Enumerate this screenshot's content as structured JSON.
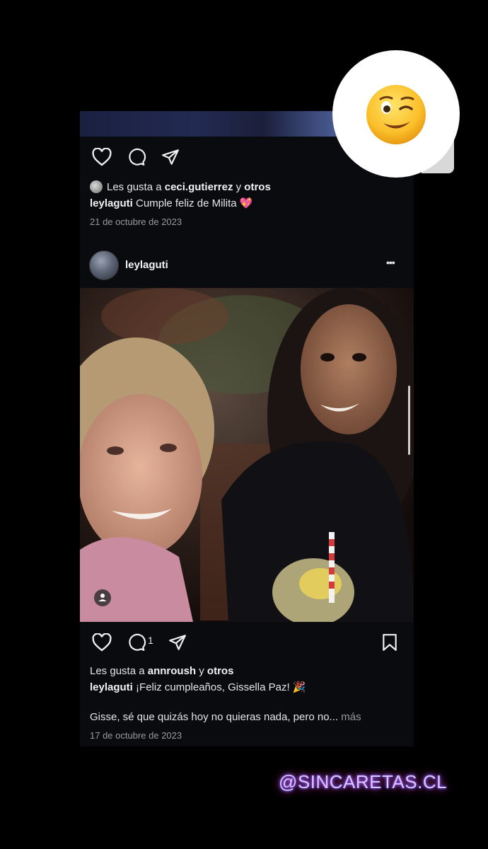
{
  "post1": {
    "likes_prefix": "Les gusta a",
    "likes_user": "ceci.gutierrez",
    "likes_and": "y",
    "likes_others": "otros",
    "caption_user": "leylaguti",
    "caption_text": "Cumple feliz de Milita 💖",
    "date": "21 de octubre de 2023"
  },
  "post2": {
    "username": "leylaguti",
    "more_label": "•••",
    "comment_count": "1",
    "likes_prefix": "Les gusta a",
    "likes_user": "annroush",
    "likes_and": "y",
    "likes_others": "otros",
    "caption_user": "leylaguti",
    "caption_text": "¡Feliz cumpleaños, Gissella Paz! 🎉",
    "caption_more_text": "Gisse, sé que quizás hoy no quieras nada, pero no...",
    "more_link": "más",
    "date": "17 de octubre de 2023"
  },
  "sticker": {
    "emoji": "winking-face"
  },
  "watermark": "@SINCARETAS.CL",
  "icons": [
    "heart-icon",
    "comment-icon",
    "share-icon",
    "bookmark-icon",
    "more-icon",
    "tag-people-icon"
  ]
}
